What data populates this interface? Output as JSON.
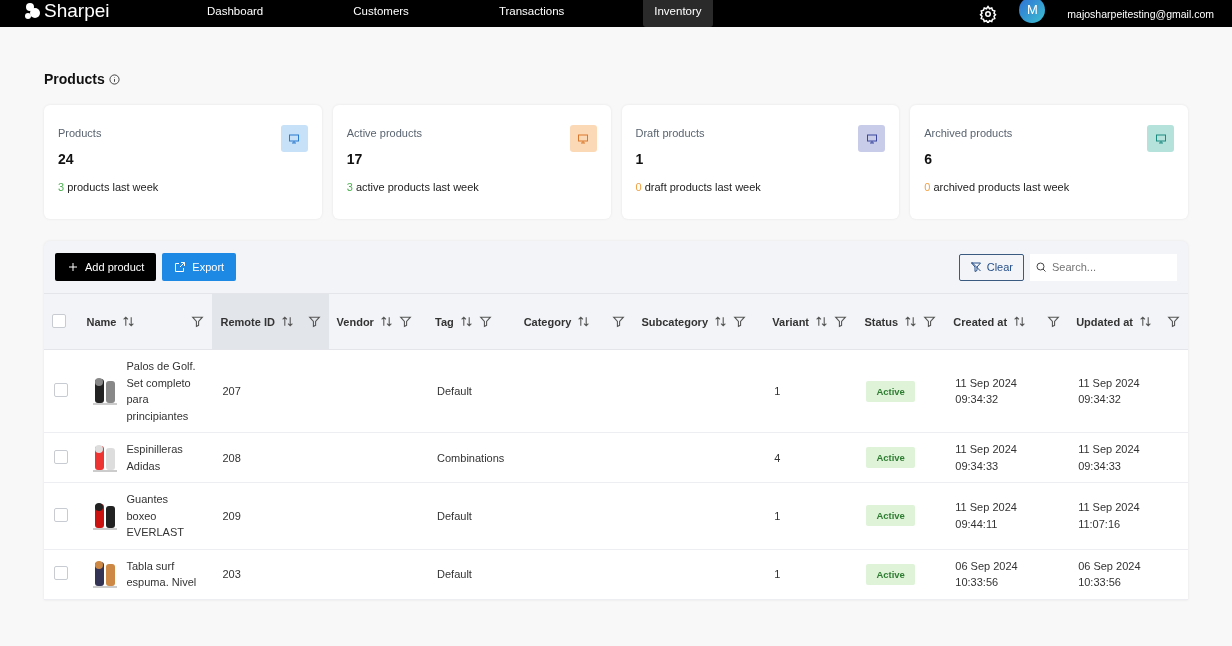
{
  "nav": {
    "logo": "Sharpei",
    "links": [
      {
        "label": "Dashboard",
        "selected": false
      },
      {
        "label": "Customers",
        "selected": false
      },
      {
        "label": "Transactions",
        "selected": false
      },
      {
        "label": "Inventory",
        "selected": true
      }
    ],
    "user": {
      "initial": "M",
      "email": "majosharpeitesting@gmail.com"
    }
  },
  "page_title": "Products",
  "stats": [
    {
      "label": "Products",
      "value": "24",
      "delta": "3",
      "delta_text": "products last week",
      "color": "#c6e1f8",
      "kind": "increase"
    },
    {
      "label": "Active products",
      "value": "17",
      "delta": "3",
      "delta_text": "active products last week",
      "color": "#fcd9b6",
      "kind": "increase"
    },
    {
      "label": "Draft products",
      "value": "1",
      "delta": "0",
      "delta_text": "draft products last week",
      "color": "#c9cce8",
      "kind": "unchanged"
    },
    {
      "label": "Archived products",
      "value": "6",
      "delta": "0",
      "delta_text": "archived products last week",
      "color": "#b6e2dc",
      "kind": "unchanged"
    }
  ],
  "toolbar": {
    "add": "Add product",
    "export": "Export",
    "clear": "Clear",
    "search_placeholder": "Search..."
  },
  "table": {
    "select_all_checked": false,
    "columns": [
      {
        "label": "Name",
        "selected": false
      },
      {
        "label": "Remote ID",
        "selected": true
      },
      {
        "label": "Vendor",
        "selected": false
      },
      {
        "label": "Tag",
        "selected": false
      },
      {
        "label": "Category",
        "selected": false
      },
      {
        "label": "Subcategory",
        "selected": false
      },
      {
        "label": "Variant",
        "selected": false
      },
      {
        "label": "Status",
        "selected": false
      },
      {
        "label": "Created at",
        "selected": false
      },
      {
        "label": "Updated at",
        "selected": false
      }
    ],
    "rows": [
      {
        "checked": false,
        "name": "Palos de Golf. Set completo para principiantes",
        "remote_id": "207",
        "tag": "Default",
        "variant": "1",
        "status": "Active",
        "created": "11 Sep 2024 09:34:32",
        "updated": "11 Sep 2024 09:34:32"
      },
      {
        "checked": false,
        "name": "Espinilleras Adidas",
        "remote_id": "208",
        "tag": "Combinations",
        "variant": "4",
        "status": "Active",
        "created": "11 Sep 2024 09:34:33",
        "updated": "11 Sep 2024 09:34:33"
      },
      {
        "checked": false,
        "name": "Guantes boxeo EVERLAST",
        "remote_id": "209",
        "tag": "Default",
        "variant": "1",
        "status": "Active",
        "created": "11 Sep 2024 09:44:11",
        "updated": "11 Sep 2024 11:07:16"
      },
      {
        "checked": false,
        "name": "Tabla surf espuma. Nivel",
        "remote_id": "203",
        "tag": "Default",
        "variant": "1",
        "status": "Active",
        "created": "06 Sep 2024 10:33:56",
        "updated": "06 Sep 2024 10:33:56"
      }
    ]
  }
}
